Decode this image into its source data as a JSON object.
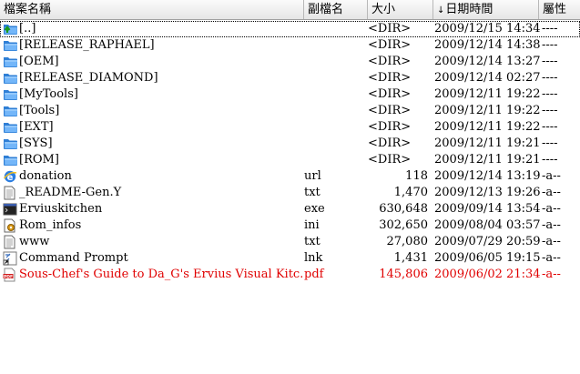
{
  "columns": {
    "name": "檔案名稱",
    "ext": "副檔名",
    "size": "大小",
    "date": "日期時間",
    "attr": "屬性",
    "sort_indicator": "↓"
  },
  "rows": [
    {
      "icon": "up-folder-icon",
      "name": "[..]",
      "ext": "",
      "size": "<DIR>",
      "date": "2009/12/15 14:34",
      "attr": "----"
    },
    {
      "icon": "folder-icon",
      "name": "[RELEASE_RAPHAEL]",
      "ext": "",
      "size": "<DIR>",
      "date": "2009/12/14 14:38",
      "attr": "----"
    },
    {
      "icon": "folder-icon",
      "name": "[OEM]",
      "ext": "",
      "size": "<DIR>",
      "date": "2009/12/14 13:27",
      "attr": "----"
    },
    {
      "icon": "folder-icon",
      "name": "[RELEASE_DIAMOND]",
      "ext": "",
      "size": "<DIR>",
      "date": "2009/12/14 02:27",
      "attr": "----"
    },
    {
      "icon": "folder-icon",
      "name": "[MyTools]",
      "ext": "",
      "size": "<DIR>",
      "date": "2009/12/11 19:22",
      "attr": "----"
    },
    {
      "icon": "folder-icon",
      "name": "[Tools]",
      "ext": "",
      "size": "<DIR>",
      "date": "2009/12/11 19:22",
      "attr": "----"
    },
    {
      "icon": "folder-icon",
      "name": "[EXT]",
      "ext": "",
      "size": "<DIR>",
      "date": "2009/12/11 19:22",
      "attr": "----"
    },
    {
      "icon": "folder-icon",
      "name": "[SYS]",
      "ext": "",
      "size": "<DIR>",
      "date": "2009/12/11 19:21",
      "attr": "----"
    },
    {
      "icon": "folder-icon",
      "name": "[ROM]",
      "ext": "",
      "size": "<DIR>",
      "date": "2009/12/11 19:21",
      "attr": "----"
    },
    {
      "icon": "ie-url-icon",
      "name": "donation",
      "ext": "url",
      "size": "118",
      "date": "2009/12/14 13:19",
      "attr": "-a--"
    },
    {
      "icon": "text-file-icon",
      "name": "_README-Gen.Y",
      "ext": "txt",
      "size": "1,470",
      "date": "2009/12/13 19:26",
      "attr": "-a--"
    },
    {
      "icon": "exe-icon",
      "name": "Erviuskitchen",
      "ext": "exe",
      "size": "630,648",
      "date": "2009/09/14 13:54",
      "attr": "-a--"
    },
    {
      "icon": "ini-settings-icon",
      "name": "Rom_infos",
      "ext": "ini",
      "size": "302,650",
      "date": "2009/08/04 03:57",
      "attr": "-a--"
    },
    {
      "icon": "text-file-icon",
      "name": "www",
      "ext": "txt",
      "size": "27,080",
      "date": "2009/07/29 20:59",
      "attr": "-a--"
    },
    {
      "icon": "shortcut-icon",
      "name": "Command Prompt",
      "ext": "lnk",
      "size": "1,431",
      "date": "2009/06/05 19:15",
      "attr": "-a--"
    },
    {
      "icon": "pdf-icon",
      "name": "Sous-Chef's Guide to Da_G's Ervius Visual Kitc...",
      "ext": "pdf",
      "size": "145,806",
      "date": "2009/06/02 21:34",
      "attr": "-a--"
    }
  ],
  "colors": {
    "folder": "#3a8ee6",
    "highlight_text": "#e00000",
    "header_bg": "#ececec"
  }
}
